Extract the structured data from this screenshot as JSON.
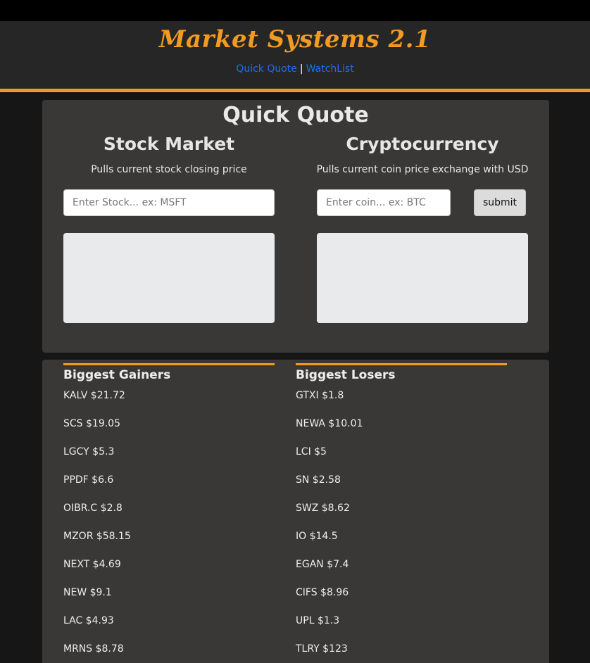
{
  "header": {
    "brand": "Market Systems 2.1",
    "nav": [
      {
        "label": "Quick Quote"
      },
      {
        "label": "WatchList"
      }
    ],
    "separator": "|"
  },
  "quick_quote": {
    "title": "Quick Quote",
    "stock": {
      "title": "Stock Market",
      "subtitle": "Pulls current stock closing price",
      "placeholder": "Enter Stock... ex: MSFT",
      "value": ""
    },
    "crypto": {
      "title": "Cryptocurrency",
      "subtitle": "Pulls current coin price exchange with USD",
      "placeholder": "Enter coin... ex: BTC",
      "value": "",
      "submit_label": "submit"
    }
  },
  "movers": {
    "gainers": {
      "title": "Biggest Gainers",
      "items": [
        "KALV $21.72",
        "SCS $19.05",
        "LGCY $5.3",
        "PPDF $6.6",
        "OIBR.C $2.8",
        "MZOR $58.15",
        "NEXT $4.69",
        "NEW $9.1",
        "LAC $4.93",
        "MRNS $8.78"
      ]
    },
    "losers": {
      "title": "Biggest Losers",
      "items": [
        "GTXI $1.8",
        "NEWA $10.01",
        "LCI $5",
        "SN $2.58",
        "SWZ $8.62",
        "IO $14.5",
        "EGAN $7.4",
        "CIFS $8.96",
        "UPL $1.3",
        "TLRY $123"
      ]
    }
  },
  "colors": {
    "accent": "#f39a21",
    "link": "#1e6ef0",
    "card": "#393837",
    "page_bg": "#161616"
  }
}
